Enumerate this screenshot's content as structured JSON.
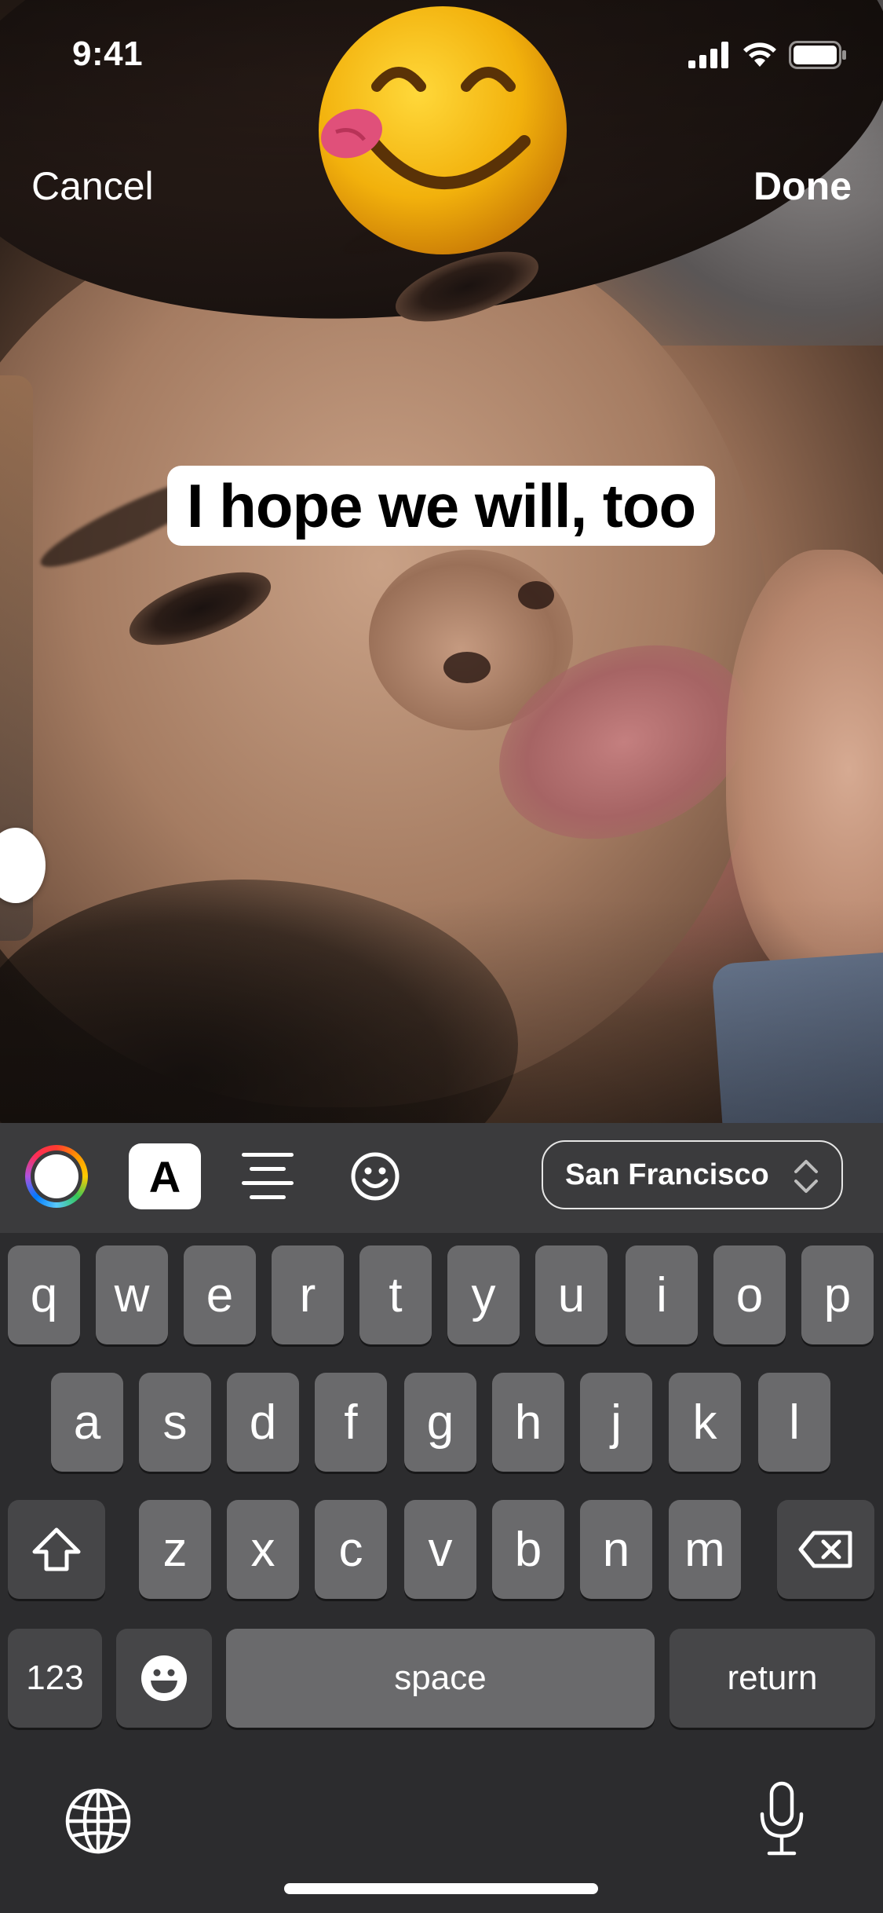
{
  "status_bar": {
    "time": "9:41",
    "signal_icon": "cellular-signal-icon",
    "wifi_icon": "wifi-icon",
    "battery_icon": "battery-icon"
  },
  "nav": {
    "cancel_label": "Cancel",
    "done_label": "Done"
  },
  "sticker": {
    "icon": "savoring-food-emoji-icon"
  },
  "caption": {
    "text": "I hope we will, too"
  },
  "toolbar": {
    "color_picker_icon": "color-wheel-icon",
    "text_style_label": "A",
    "align_icon": "text-align-center-icon",
    "emoji_icon": "smiley-icon",
    "font_label": "San Francisco",
    "font_chevron_icon": "chevron-up-down-icon"
  },
  "keyboard": {
    "row1": [
      "q",
      "w",
      "e",
      "r",
      "t",
      "y",
      "u",
      "i",
      "o",
      "p"
    ],
    "row2": [
      "a",
      "s",
      "d",
      "f",
      "g",
      "h",
      "j",
      "k",
      "l"
    ],
    "row3": [
      "z",
      "x",
      "c",
      "v",
      "b",
      "n",
      "m"
    ],
    "numbers_label": "123",
    "space_label": "space",
    "return_label": "return",
    "shift_icon": "shift-icon",
    "delete_icon": "delete-icon",
    "emoji_key_icon": "emoji-keyboard-icon",
    "globe_icon": "globe-icon",
    "mic_icon": "microphone-icon"
  },
  "colors": {
    "toolbar_bg": "#3b3b3d",
    "keyboard_bg": "#2c2c2e",
    "key_bg": "#6a6a6c",
    "key_dark_bg": "#464648",
    "caption_bg": "#ffffff"
  }
}
